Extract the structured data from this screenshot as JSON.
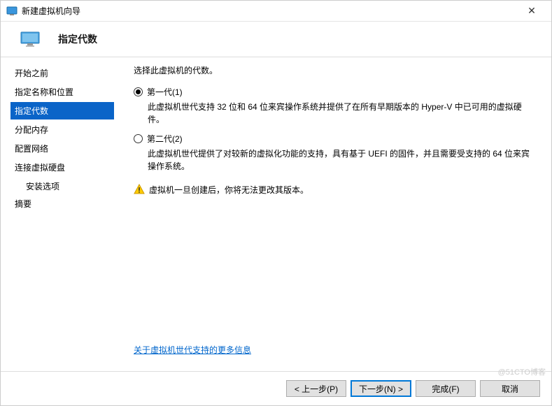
{
  "window": {
    "title": "新建虚拟机向导"
  },
  "header": {
    "heading": "指定代数"
  },
  "sidebar": {
    "items": [
      {
        "label": "开始之前"
      },
      {
        "label": "指定名称和位置"
      },
      {
        "label": "指定代数"
      },
      {
        "label": "分配内存"
      },
      {
        "label": "配置网络"
      },
      {
        "label": "连接虚拟硬盘"
      }
    ],
    "sub": {
      "label": "安装选项"
    },
    "last": {
      "label": "摘要"
    }
  },
  "content": {
    "instruction": "选择此虚拟机的代数。",
    "gen1": {
      "label": "第一代(1)",
      "desc": "此虚拟机世代支持 32 位和 64 位来宾操作系统并提供了在所有早期版本的 Hyper-V 中已可用的虚拟硬件。"
    },
    "gen2": {
      "label": "第二代(2)",
      "desc": "此虚拟机世代提供了对较新的虚拟化功能的支持，具有基于 UEFI 的固件，并且需要受支持的 64 位来宾操作系统。"
    },
    "warning": "虚拟机一旦创建后，你将无法更改其版本。",
    "link": "关于虚拟机世代支持的更多信息"
  },
  "footer": {
    "back": "< 上一步(P)",
    "next": "下一步(N) >",
    "finish": "完成(F)",
    "cancel": "取消"
  },
  "watermark": "@51CTO博客"
}
